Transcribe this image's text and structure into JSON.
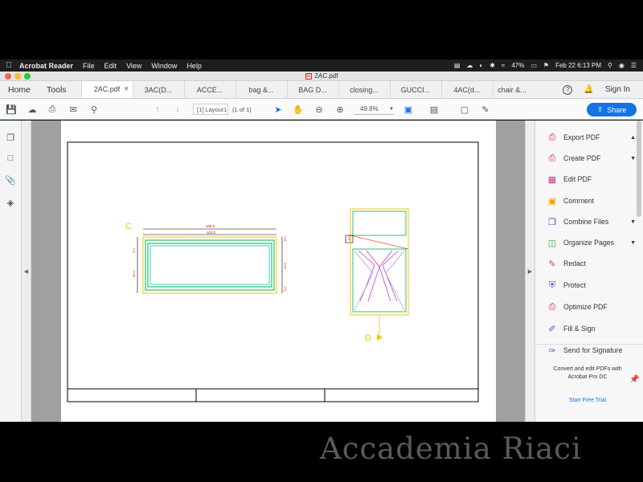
{
  "menubar": {
    "app_name": "Acrobat Reader",
    "items": [
      "File",
      "Edit",
      "View",
      "Window",
      "Help"
    ],
    "battery": "47%",
    "datetime": "Feb 22  6:13 PM"
  },
  "window": {
    "title": "2AC.pdf"
  },
  "nav": {
    "home": "Home",
    "tools": "Tools"
  },
  "tabs": [
    {
      "label": "2AC.pdf",
      "active": true
    },
    {
      "label": "3AC(D..."
    },
    {
      "label": "ACCE..."
    },
    {
      "label": "bag &..."
    },
    {
      "label": "BAG D..."
    },
    {
      "label": "closing..."
    },
    {
      "label": "GUCCI..."
    },
    {
      "label": "4AC(d..."
    },
    {
      "label": "chair &..."
    }
  ],
  "header_right": {
    "help": "?",
    "sign_in": "Sign In"
  },
  "toolbar": {
    "page_field": "[1] Layout1",
    "page_count": "(1 of 1)",
    "zoom": "49.8%",
    "share": "Share"
  },
  "tools": [
    {
      "label": "Export PDF",
      "icon": "export-pdf-icon",
      "color": "#d9262e",
      "chevron": "up"
    },
    {
      "label": "Create PDF",
      "icon": "create-pdf-icon",
      "color": "#d9262e",
      "chevron": "down"
    },
    {
      "label": "Edit PDF",
      "icon": "edit-pdf-icon",
      "color": "#d0328c"
    },
    {
      "label": "Comment",
      "icon": "comment-icon",
      "color": "#f0a400"
    },
    {
      "label": "Combine Files",
      "icon": "combine-files-icon",
      "color": "#5a3fc8",
      "chevron": "down"
    },
    {
      "label": "Organize Pages",
      "icon": "organize-pages-icon",
      "color": "#3aa23a",
      "chevron": "down"
    },
    {
      "label": "Redact",
      "icon": "redact-icon",
      "color": "#d0328c"
    },
    {
      "label": "Protect",
      "icon": "protect-icon",
      "color": "#4b3fc8"
    },
    {
      "label": "Optimize PDF",
      "icon": "optimize-pdf-icon",
      "color": "#d9262e"
    },
    {
      "label": "Fill & Sign",
      "icon": "fill-sign-icon",
      "color": "#7a3fc8"
    },
    {
      "label": "Send for Signature",
      "icon": "send-signature-icon",
      "color": "#7a3fc8"
    }
  ],
  "promo": {
    "text": "Convert and edit PDFs with Acrobat Pro DC",
    "trial": "Start Free Trial"
  },
  "drawing": {
    "label_c": "C",
    "label_d": "D",
    "dims_top": [
      "106.0",
      "101.0"
    ],
    "dims_left": [
      "3.0",
      "10.0",
      "56.5",
      "10.5",
      "10.0"
    ],
    "dims_right": [
      "8.0",
      "10.0",
      "10.0",
      "10.0",
      "10.0",
      "3.0"
    ],
    "dim_small": "10.0"
  },
  "watermark": "Accademia Riaci"
}
